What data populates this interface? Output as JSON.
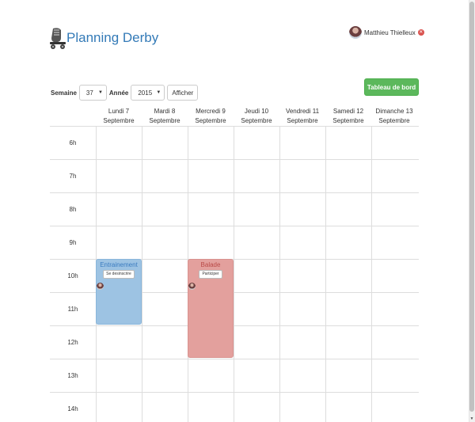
{
  "header": {
    "title": "Planning Derby",
    "logo_icon": "skate-icon"
  },
  "user": {
    "name": "Matthieu Thielleux",
    "logout_icon": "logout-icon"
  },
  "filters": {
    "week_label": "Semaine",
    "week_value": "37",
    "year_label": "Année",
    "year_value": "2015",
    "submit_label": "Afficher"
  },
  "dashboard_label": "Tableau de bord",
  "days": [
    {
      "line1": "Lundi 7",
      "line2": "Septembre"
    },
    {
      "line1": "Mardi 8",
      "line2": "Septembre"
    },
    {
      "line1": "Mercredi 9",
      "line2": "Septembre"
    },
    {
      "line1": "Jeudi 10",
      "line2": "Septembre"
    },
    {
      "line1": "Vendredi 11",
      "line2": "Septembre"
    },
    {
      "line1": "Samedi 12",
      "line2": "Septembre"
    },
    {
      "line1": "Dimanche 13",
      "line2": "Septembre"
    }
  ],
  "hours": [
    "6h",
    "7h",
    "8h",
    "9h",
    "10h",
    "11h",
    "12h",
    "13h",
    "14h"
  ],
  "events": [
    {
      "title": "Entrainement",
      "button_label": "Se desinscrire",
      "day": "Lundi 7",
      "start": "10h",
      "end": "12h",
      "color": "#9dc3e3"
    },
    {
      "title": "Balade",
      "button_label": "Participer",
      "day": "Mercredi 9",
      "start": "10h",
      "end": "13h",
      "color": "#e3a09d"
    }
  ],
  "colors": {
    "brand": "#337ab7",
    "success": "#5cb85c",
    "danger": "#d9534f"
  }
}
